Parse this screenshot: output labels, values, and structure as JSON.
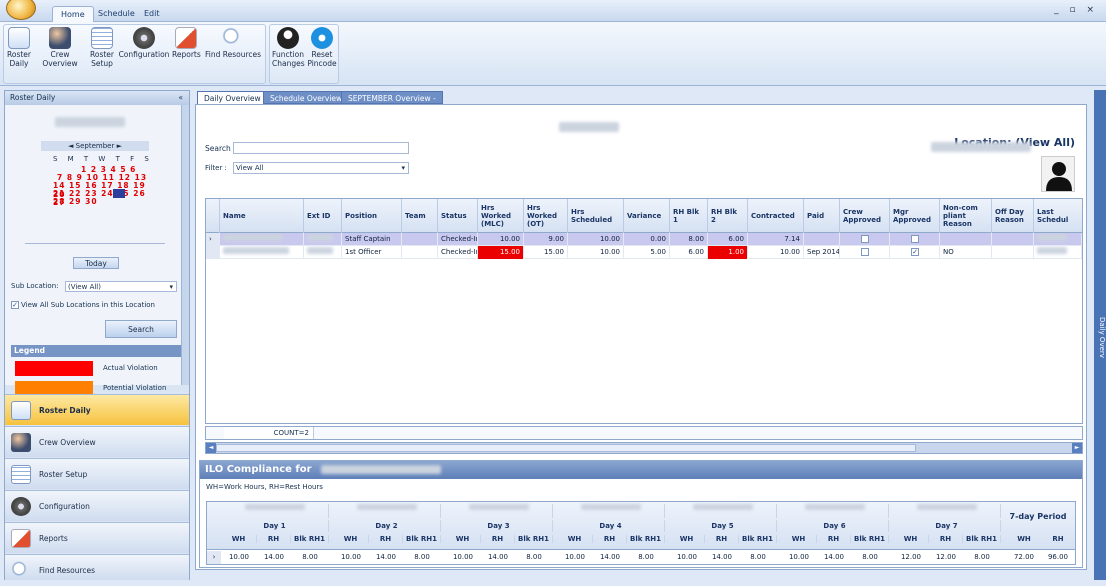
{
  "ribbon_tabs": [
    "Home",
    "Schedule",
    "Edit"
  ],
  "window_controls": "_ ▫ ×",
  "ribbon_buttons": [
    {
      "label": "Roster\nDaily",
      "icon": "roster-daily-icon"
    },
    {
      "label": "Crew Overview",
      "icon": "crew-overview-icon"
    },
    {
      "label": "Roster\nSetup",
      "icon": "roster-setup-icon"
    },
    {
      "label": "Configuration",
      "icon": "configuration-icon"
    },
    {
      "label": "Reports",
      "icon": "reports-icon"
    },
    {
      "label": "Find Resources",
      "icon": "find-resources-icon"
    },
    {
      "label": "Function\nChanges",
      "icon": "function-changes-icon"
    },
    {
      "label": "Reset\nPincode",
      "icon": "reset-pincode-icon"
    }
  ],
  "left_panel": {
    "title": "Roster Daily",
    "collapse": "«",
    "calendar": {
      "month": "September",
      "nav_prev": "◄",
      "nav_next": "►",
      "dow": "S M T W T F S",
      "rows": [
        "1 2 3 4 5 6",
        "7 8 9 10 11 12 13",
        "14 15 16 17 18 19 20",
        "21 22 23 24 25 26 27",
        "28 29 30"
      ],
      "selected_day": "25"
    },
    "today_label": "Today",
    "sub_location_label": "Sub Location:",
    "sub_location_value": "(View All)",
    "view_all_check_label": "View All Sub Locations in this Location",
    "search_button": "Search",
    "legend_title": "Legend",
    "legend": [
      {
        "label": "Actual Violation",
        "color": "#ff0000"
      },
      {
        "label": "Potential Violation",
        "color": "#ff7f00"
      }
    ],
    "nav": [
      "Roster Daily",
      "Crew Overview",
      "Roster Setup",
      "Configuration",
      "Reports",
      "Find Resources"
    ]
  },
  "doc_tabs": [
    "Daily Overview",
    "Schedule Overview",
    "SEPTEMBER Overview -"
  ],
  "right_strip": "Daily Overv",
  "main": {
    "location": "Location: (View All)",
    "search_label": "Search",
    "filter_label": "Filter :",
    "filter_value": "View All",
    "columns": [
      "Name",
      "Ext ID",
      "Position",
      "Team",
      "Status",
      "Hrs Worked (MLC)",
      "Hrs Worked (OT)",
      "Hrs Scheduled",
      "Variance",
      "RH Blk 1",
      "RH Blk 2",
      "Contracted",
      "Paid",
      "Crew Approved",
      "Mgr Approved",
      "Non-com pliant Reason",
      "Off Day Reason",
      "Last Schedul"
    ],
    "rows": [
      {
        "position": "Staff Captain",
        "status": "Checked-In",
        "mlc": "10.00",
        "ot": "9.00",
        "sched": "10.00",
        "var": "0.00",
        "rh1": "8.00",
        "rh2": "6.00",
        "contracted": "7.14",
        "paid": "",
        "crew_approved": "",
        "mgr_approved": "",
        "reason": ""
      },
      {
        "position": "1st Officer",
        "status": "Checked-In",
        "mlc": "15.00",
        "ot": "15.00",
        "sched": "10.00",
        "var": "5.00",
        "rh1": "6.00",
        "rh2": "1.00",
        "contracted": "10.00",
        "paid": "Sep 2014",
        "crew_approved": "",
        "mgr_approved": "✓",
        "reason": "NO"
      }
    ],
    "count": "COUNT=2"
  },
  "ilo": {
    "title": "ILO Compliance for",
    "note": "WH=Work Hours, RH=Rest Hours",
    "days": [
      "Day 1",
      "Day 2",
      "Day 3",
      "Day 4",
      "Day 5",
      "Day 6",
      "Day 7"
    ],
    "sub_headers": [
      "WH",
      "RH",
      "Blk RH1"
    ],
    "period_title": "7-day Period",
    "period_sub": [
      "WH",
      "RH"
    ],
    "values": [
      [
        "10.00",
        "14.00",
        "8.00"
      ],
      [
        "10.00",
        "14.00",
        "8.00"
      ],
      [
        "10.00",
        "14.00",
        "8.00"
      ],
      [
        "10.00",
        "14.00",
        "8.00"
      ],
      [
        "10.00",
        "14.00",
        "8.00"
      ],
      [
        "10.00",
        "14.00",
        "8.00"
      ],
      [
        "12.00",
        "12.00",
        "8.00"
      ]
    ],
    "period_values": [
      "72.00",
      "96.00"
    ]
  }
}
